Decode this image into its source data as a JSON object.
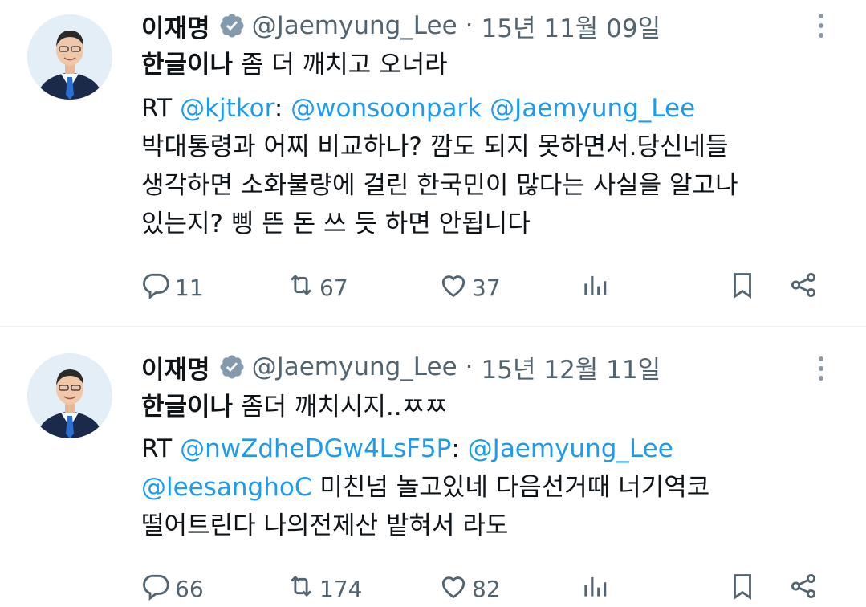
{
  "tweets": [
    {
      "name": "이재명",
      "handle": "@Jaemyung_Lee",
      "separator": "·",
      "date": "15년 11월 09일",
      "body": {
        "l1_bold": "한글이나",
        "l1_rest": " 좀 더 깨치고 오너라",
        "l2_rt": "RT ",
        "l2_link1": "@kjtkor",
        "l2_colon": ": ",
        "l2_link2": "@wonsoonpark",
        "l2_space": " ",
        "l2_link3": "@Jaemyung_Lee",
        "l3": "박대통령과 어찌 비교하나? 깜도 되지 못하면서.당신네들",
        "l4": "생각하면 소화불량에 걸린 한국민이 많다는 사실을 알고나",
        "l5": "있는지? 삥 뜬 돈 쓰 듯 하면 안됩니다"
      },
      "replies": "11",
      "retweets": "67",
      "likes": "37"
    },
    {
      "name": "이재명",
      "handle": "@Jaemyung_Lee",
      "separator": "·",
      "date": "15년 12월 11일",
      "body": {
        "l1_bold": "한글이나",
        "l1_rest": " 좀더 깨치시지..ㅉㅉ",
        "l2_rt": "RT ",
        "l2_link1": "@nwZdheDGw4LsF5P",
        "l2_colon": ": ",
        "l2_link2": "@Jaemyung_Lee",
        "l3_link": "@leesanghoC",
        "l3_rest": " 미친넘  놀고있네 다음선거때 너기역코",
        "l4": "떨어트린다 나의전제산 밭혀서 라도"
      },
      "replies": "66",
      "retweets": "174",
      "likes": "82"
    }
  ],
  "icons": {
    "verified": "verified-badge-icon",
    "more": "more-options-icon",
    "reply": "reply-icon",
    "retweet": "retweet-icon",
    "like": "heart-icon",
    "views": "views-icon",
    "bookmark": "bookmark-icon",
    "share": "share-icon"
  },
  "colors": {
    "link": "#1d9bf0",
    "secondary_text": "#536471",
    "primary_text": "#0f1419",
    "divider": "#eff3f4"
  }
}
